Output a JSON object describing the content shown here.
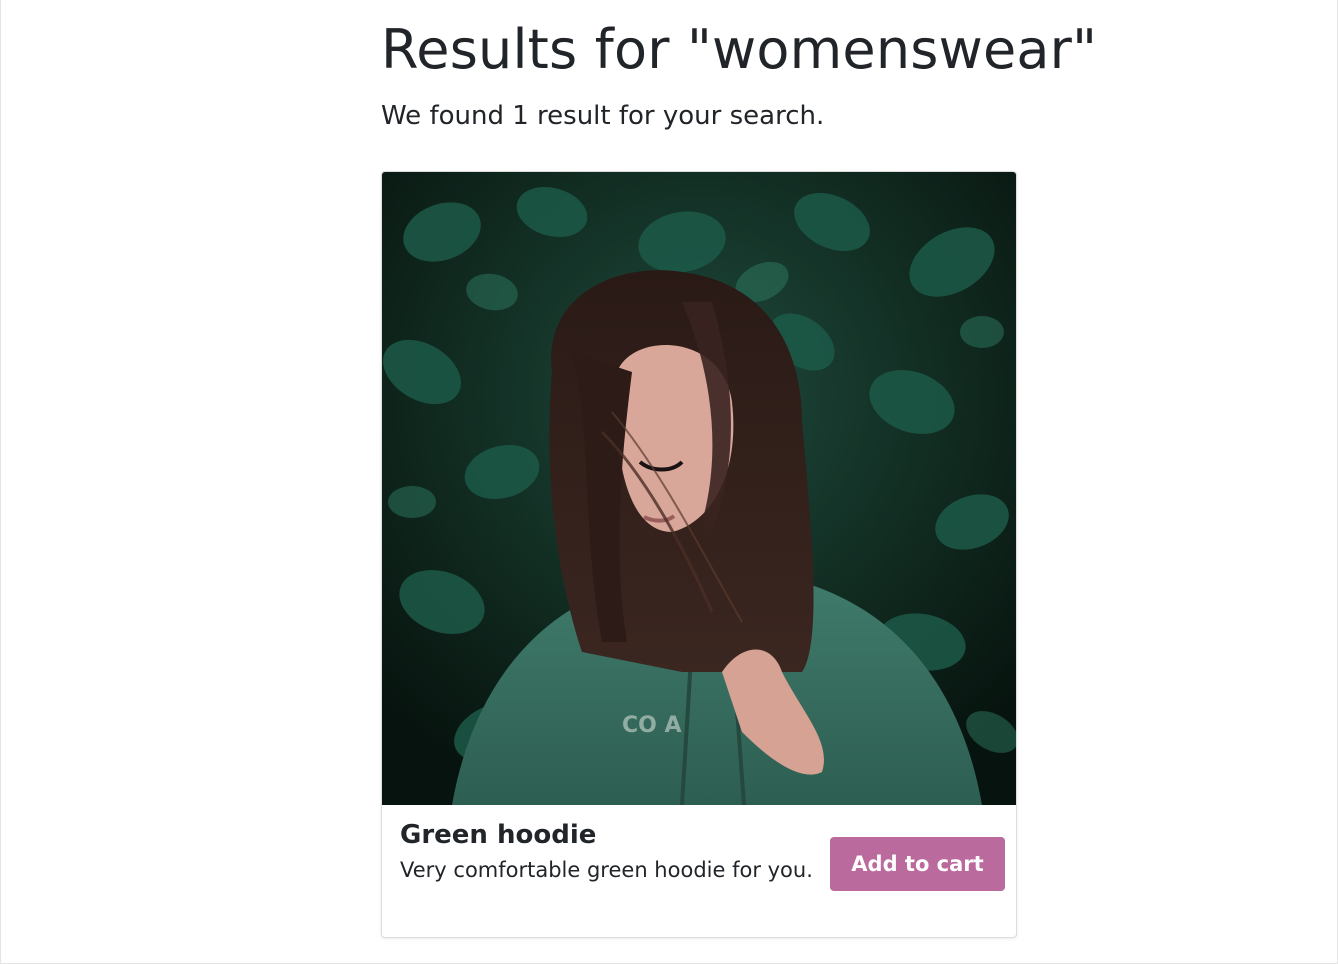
{
  "search": {
    "title": "Results for \"womenswear\"",
    "summary": "We found 1 result for your search."
  },
  "results": [
    {
      "name": "Green hoodie",
      "description": "Very comfortable green hoodie for you.",
      "button_label": "Add to cart",
      "image_alt": "Woman with long dark hair wearing a green hoodie in front of ivy leaves"
    }
  ],
  "colors": {
    "button": "#bb6a9e",
    "text": "#212529",
    "card_border": "#dcdcdc"
  }
}
